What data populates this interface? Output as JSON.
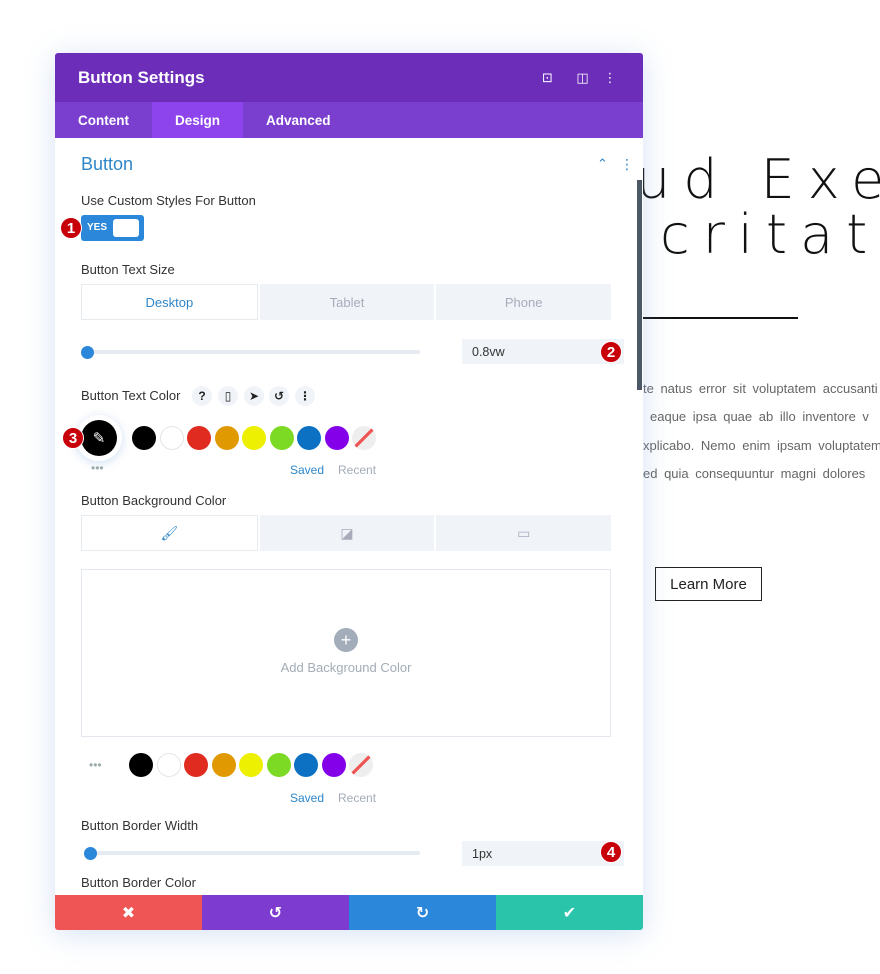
{
  "background": {
    "heading_line1": "ud Exe",
    "heading_line2": "critat",
    "paragraph": [
      "te natus error sit voluptatem accusanti",
      "eaque ipsa quae ab illo inventore v",
      "xplicabo. Nemo enim ipsam voluptatem",
      "ed quia consequuntur magni dolores"
    ],
    "button_label": "Learn More"
  },
  "panel": {
    "title": "Button Settings",
    "header_icons": [
      "focus-icon",
      "split-view-icon",
      "more-vertical-icon"
    ],
    "tabs": [
      {
        "label": "Content"
      },
      {
        "label": "Design",
        "active": true
      },
      {
        "label": "Advanced"
      }
    ],
    "section_title": "Button",
    "custom_styles": {
      "label": "Use Custom Styles For Button",
      "value": "YES"
    },
    "text_size": {
      "label": "Button Text Size",
      "devices": [
        "Desktop",
        "Tablet",
        "Phone"
      ],
      "value": "0.8vw",
      "slider_fraction": 0.0
    },
    "text_color": {
      "label": "Button Text Color",
      "icons": [
        "help-icon",
        "mobile-icon",
        "cursor-icon",
        "reset-icon",
        "more-icon"
      ],
      "selected": "#000000"
    },
    "swatches": [
      "#000000",
      "#ffffff",
      "#e02b20",
      "#e09900",
      "#edf000",
      "#7cda24",
      "#0c71c3",
      "#8300e9"
    ],
    "saved_label": "Saved",
    "recent_label": "Recent",
    "bg_color": {
      "label": "Button Background Color",
      "tabs": [
        "color-icon",
        "gradient-icon",
        "image-icon"
      ],
      "add_label": "Add Background Color",
      "add_symbol": "+"
    },
    "border_width": {
      "label": "Button Border Width",
      "value": "1px",
      "slider_fraction": 0.0
    },
    "next_label": "Button Border Color",
    "footer": {
      "cancel": "✖",
      "undo": "↺",
      "redo": "↻",
      "save": "✔"
    },
    "badges": [
      "1",
      "2",
      "3",
      "4"
    ],
    "colors": {
      "header": "#6c2eb9",
      "tabs": "#7b3fd0",
      "accent": "#2b87da",
      "cancel": "#ef5555",
      "undo": "#7e3bd0",
      "redo": "#2b87da",
      "save": "#29c4a9"
    }
  }
}
